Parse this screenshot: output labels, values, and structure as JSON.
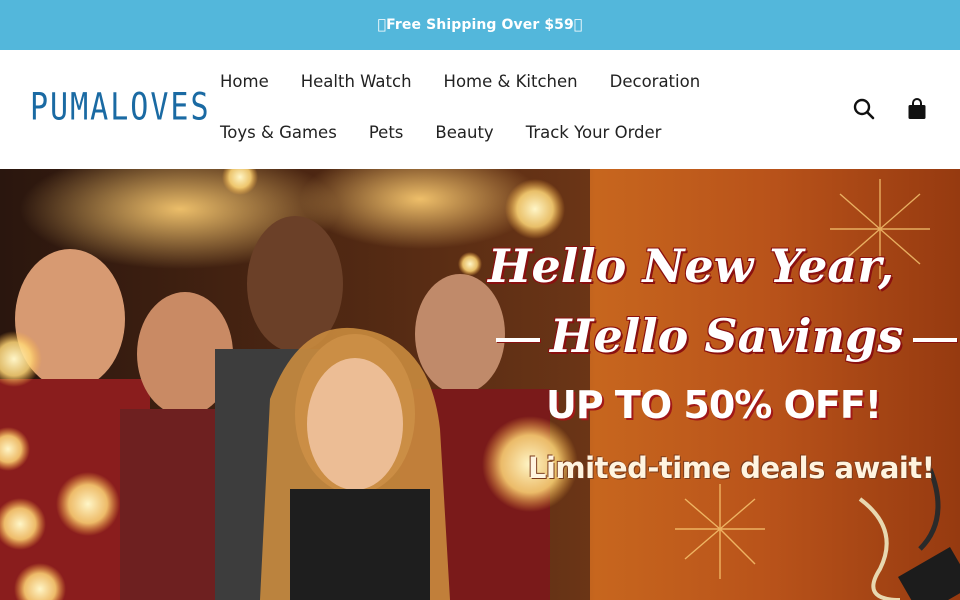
{
  "announcement": {
    "text": "\u0000Free Shipping Over $59\u0000"
  },
  "brand": {
    "logo_text": "PUMALOVES"
  },
  "nav": {
    "row1": [
      "Home",
      "Health Watch",
      "Home & Kitchen",
      "Decoration"
    ],
    "row2": [
      "Toys & Games",
      "Pets",
      "Beauty",
      "Track Your Order"
    ]
  },
  "icons": {
    "search": "search-icon",
    "cart": "shopping-bag-icon"
  },
  "hero": {
    "line1": "Hello New Year,",
    "line2": "Hello Savings",
    "offer": "UP TO 50% OFF!",
    "sub": "Limited-time deals await!"
  },
  "colors": {
    "announce_bg": "#53b7db",
    "logo": "#1a6aa3",
    "hero_orange": "#c7661e"
  }
}
